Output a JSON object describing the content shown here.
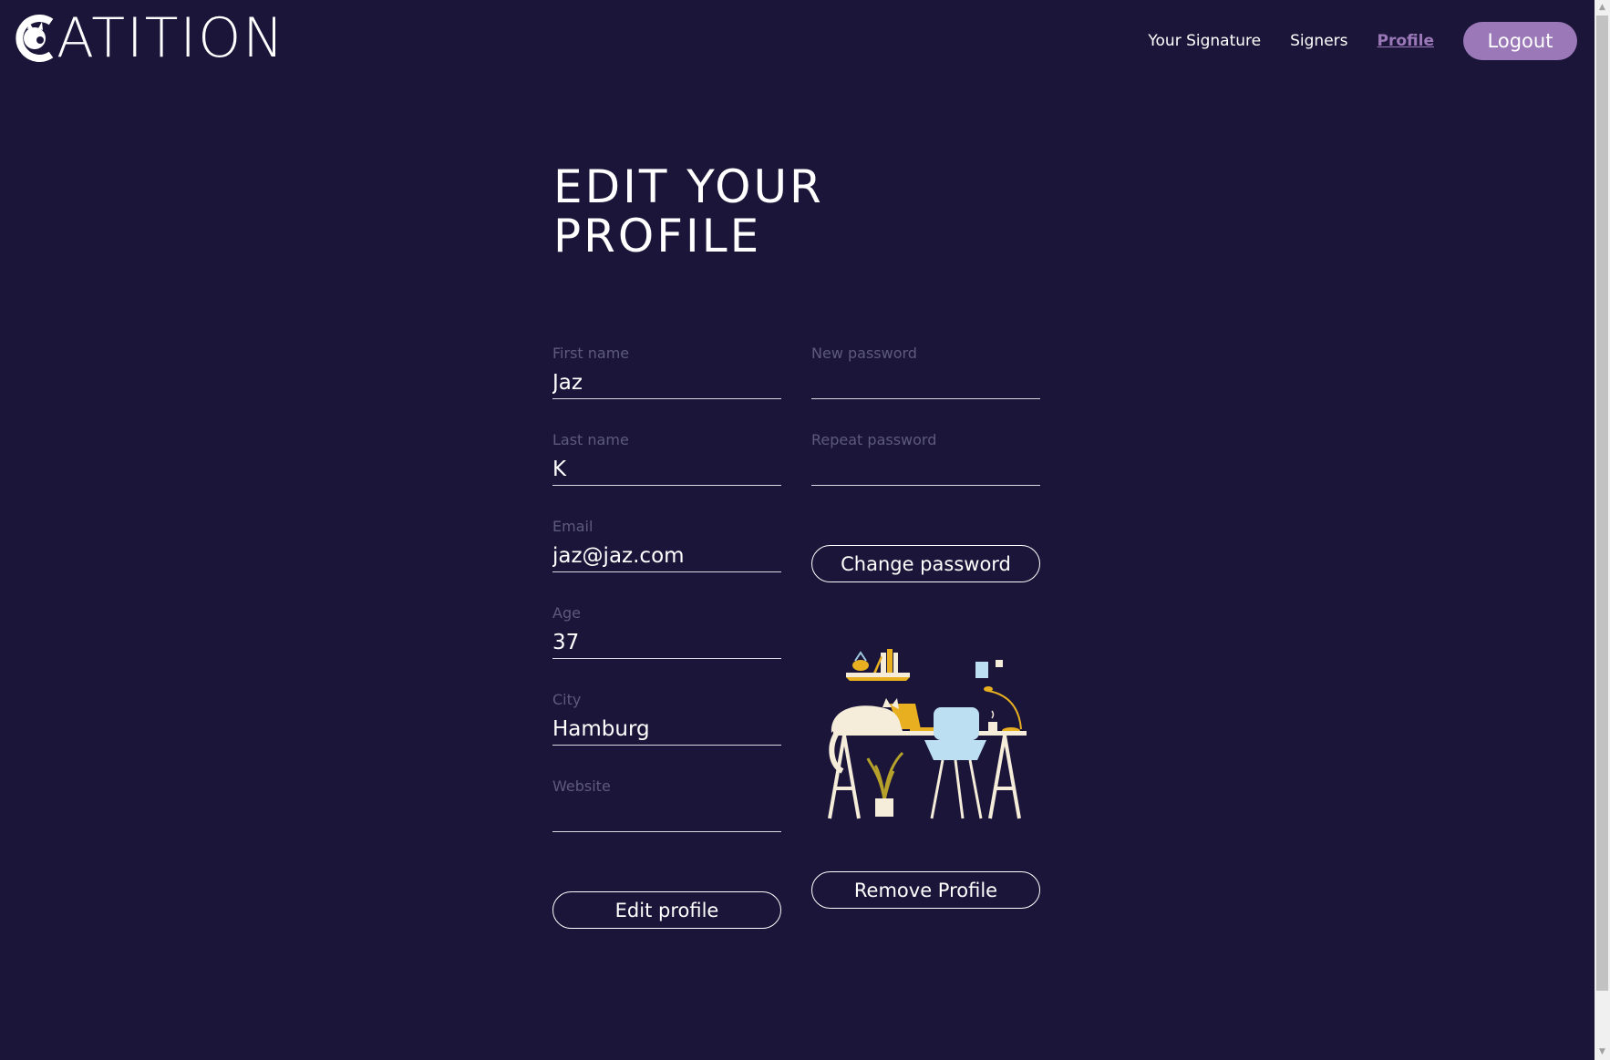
{
  "app": {
    "logo_text": "ATITION"
  },
  "nav": {
    "items": [
      {
        "label": "Your Signature"
      },
      {
        "label": "Signers"
      },
      {
        "label": "Profile"
      }
    ],
    "logout_label": "Logout"
  },
  "page": {
    "title_line1": "EDIT YOUR",
    "title_line2": "PROFILE"
  },
  "form": {
    "first_name": {
      "label": "First name",
      "value": "Jaz"
    },
    "last_name": {
      "label": "Last name",
      "value": "K"
    },
    "email": {
      "label": "Email",
      "value": "jaz@jaz.com"
    },
    "age": {
      "label": "Age",
      "value": "37"
    },
    "city": {
      "label": "City",
      "value": "Hamburg"
    },
    "website": {
      "label": "Website",
      "value": ""
    },
    "new_password": {
      "label": "New password",
      "value": ""
    },
    "repeat_password": {
      "label": "Repeat password",
      "value": ""
    },
    "edit_label": "Edit profile",
    "change_password_label": "Change password",
    "remove_label": "Remove Profile"
  },
  "colors": {
    "background": "#1b1639",
    "accent": "#9b78b8",
    "muted_label": "#5e5a7c"
  }
}
